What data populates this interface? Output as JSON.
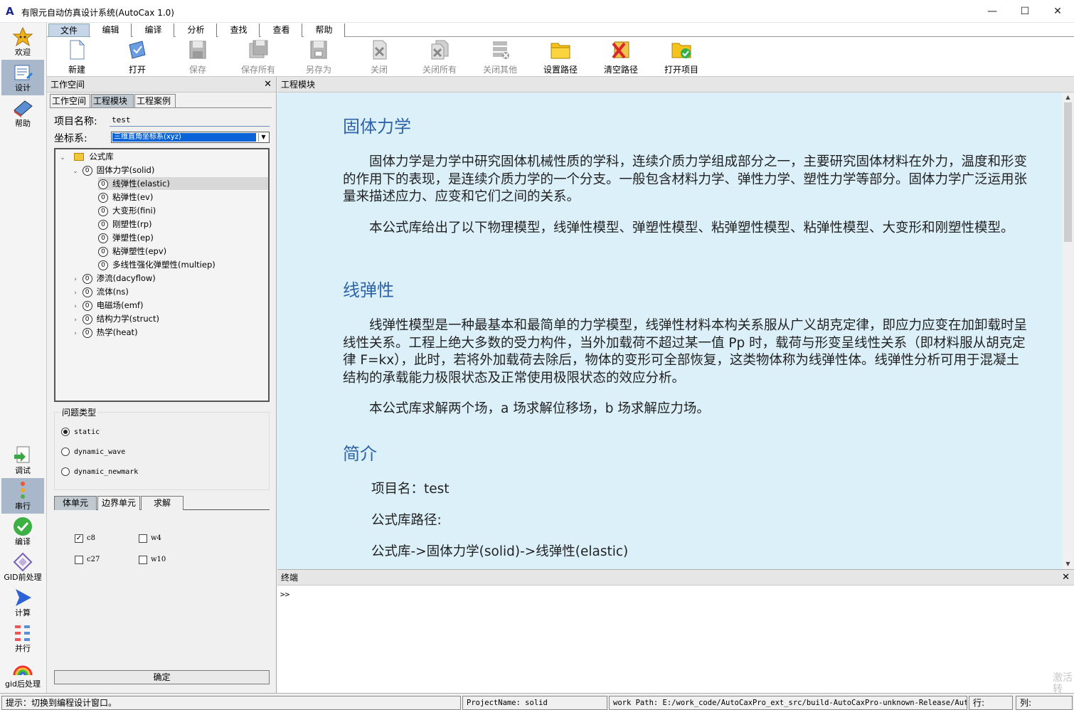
{
  "window": {
    "title": "有限元自动仿真设计系统(AutoCax 1.0)",
    "logo": "A",
    "minimize": "—",
    "maximize": "☐",
    "close": "✕"
  },
  "sidebar": {
    "top": [
      {
        "label": "欢迎",
        "icon": "star-icon"
      },
      {
        "label": "设计",
        "icon": "design-icon"
      },
      {
        "label": "帮助",
        "icon": "book-icon"
      }
    ],
    "bottom": [
      {
        "label": "调试",
        "icon": "debug-icon"
      },
      {
        "label": "串行",
        "icon": "serial-icon"
      },
      {
        "label": "编译",
        "icon": "check-icon"
      },
      {
        "label": "GID前处理",
        "icon": "preprocess-icon"
      },
      {
        "label": "计算",
        "icon": "play-icon"
      },
      {
        "label": "并行",
        "icon": "parallel-icon"
      },
      {
        "label": "gid后处理",
        "icon": "rainbow-icon"
      }
    ]
  },
  "menu": [
    "文件",
    "编辑",
    "编译",
    "分析",
    "查找",
    "查看",
    "帮助"
  ],
  "toolbar": [
    {
      "label": "新建",
      "icon": "new-file-icon",
      "enabled": true
    },
    {
      "label": "打开",
      "icon": "open-icon",
      "enabled": true
    },
    {
      "label": "保存",
      "icon": "save-icon",
      "enabled": false
    },
    {
      "label": "保存所有",
      "icon": "save-all-icon",
      "enabled": false
    },
    {
      "label": "另存为",
      "icon": "save-as-icon",
      "enabled": false
    },
    {
      "label": "关闭",
      "icon": "close-file-icon",
      "enabled": false
    },
    {
      "label": "关闭所有",
      "icon": "close-all-icon",
      "enabled": false
    },
    {
      "label": "关闭其他",
      "icon": "close-others-icon",
      "enabled": false
    },
    {
      "label": "设置路径",
      "icon": "folder-icon",
      "enabled": true
    },
    {
      "label": "清空路径",
      "icon": "clear-path-icon",
      "enabled": true
    },
    {
      "label": "打开项目",
      "icon": "open-project-icon",
      "enabled": true
    }
  ],
  "workspace": {
    "header": "工作空间",
    "close": "✕",
    "tabs": [
      "工作空间",
      "工程模块",
      "工程案例"
    ],
    "project_name_label": "项目名称:",
    "project_name_value": "test",
    "coord_label": "坐标系:",
    "coord_value": "三维直角坐标系(xyz)",
    "tree": [
      {
        "label": "公式库",
        "twisty": "⌄",
        "kind": "folder"
      },
      {
        "label": "固体力学(solid)",
        "twisty": "⌄",
        "kind": "node"
      },
      {
        "label": "线弹性(elastic)",
        "twisty": "",
        "kind": "node",
        "selected": true
      },
      {
        "label": "粘弹性(ev)",
        "twisty": "",
        "kind": "node"
      },
      {
        "label": "大变形(fini)",
        "twisty": "",
        "kind": "node"
      },
      {
        "label": "刚塑性(rp)",
        "twisty": "",
        "kind": "node"
      },
      {
        "label": "弹塑性(ep)",
        "twisty": "",
        "kind": "node"
      },
      {
        "label": "粘弹塑性(epv)",
        "twisty": "",
        "kind": "node"
      },
      {
        "label": "多线性强化弹塑性(multiep)",
        "twisty": "",
        "kind": "node"
      },
      {
        "label": "渗流(dacyflow)",
        "twisty": "›",
        "kind": "node"
      },
      {
        "label": "流体(ns)",
        "twisty": "›",
        "kind": "node"
      },
      {
        "label": "电磁场(emf)",
        "twisty": "›",
        "kind": "node"
      },
      {
        "label": "结构力学(struct)",
        "twisty": "›",
        "kind": "node"
      },
      {
        "label": "热学(heat)",
        "twisty": "›",
        "kind": "node"
      }
    ],
    "node_marker": "0",
    "problem_type_label": "问题类型",
    "problem_types": [
      {
        "label": "static",
        "checked": true
      },
      {
        "label": "dynamic_wave",
        "checked": false
      },
      {
        "label": "dynamic_newmark",
        "checked": false
      }
    ],
    "unit_tabs": [
      "体单元",
      "边界单元",
      "求解"
    ],
    "elements": [
      {
        "label": "c8",
        "checked": true
      },
      {
        "label": "w4",
        "checked": false
      },
      {
        "label": "c27",
        "checked": false
      },
      {
        "label": "w10",
        "checked": false
      }
    ],
    "ok_button": "确定"
  },
  "doc": {
    "header": "工程模块",
    "h1": "固体力学",
    "p1": "固体力学是力学中研究固体机械性质的学科，连续介质力学组成部分之一，主要研究固体材料在外力，温度和形变的作用下的表现，是连续介质力学的一个分支。一般包含材料力学、弹性力学、塑性力学等部分。固体力学广泛运用张量来描述应力、应变和它们之间的关系。",
    "p2": "本公式库给出了以下物理模型，线弹性模型、弹塑性模型、粘弹塑性模型、粘弹性模型、大变形和刚塑性模型。",
    "h2": "线弹性",
    "p3": "线弹性模型是一种最基本和最简单的力学模型，线弹性材料本构关系服从广义胡克定律，即应力应变在加卸载时呈线性关系。工程上绝大多数的受力构件，当外加载荷不超过某一值 Pp 时，载荷与形变呈线性关系（即材料服从胡克定律 F=kx），此时，若将外加载荷去除后，物体的变形可全部恢复，这类物体称为线弹性体。线弹性分析可用于混凝土结构的承载能力极限状态及正常使用极限状态的效应分析。",
    "p4": "本公式库求解两个场，a 场求解位移场，b 场求解应力场。",
    "h3": "简介",
    "line1": "项目名：test",
    "line2": "公式库路径:",
    "line3": "公式库->固体力学(solid)->线弹性(elastic)"
  },
  "terminal": {
    "header": "终端",
    "close": "✕",
    "prompt": ">>",
    "watermark": "激活\n转"
  },
  "status": {
    "hint": "提示：切换到编程设计窗口。",
    "project": "ProjectName: solid",
    "work_path": "work Path: E:/work_code/AutoCaxPro_ext_src/build-AutoCaxPro-unknown-Release/AutoCAX",
    "row": "行:",
    "col": "列:"
  },
  "colors": {
    "doc_background": "#dcf0fa",
    "heading": "#2e63a6",
    "selection": "#0a64d8",
    "active_sidebar": "#a8b7c9"
  }
}
